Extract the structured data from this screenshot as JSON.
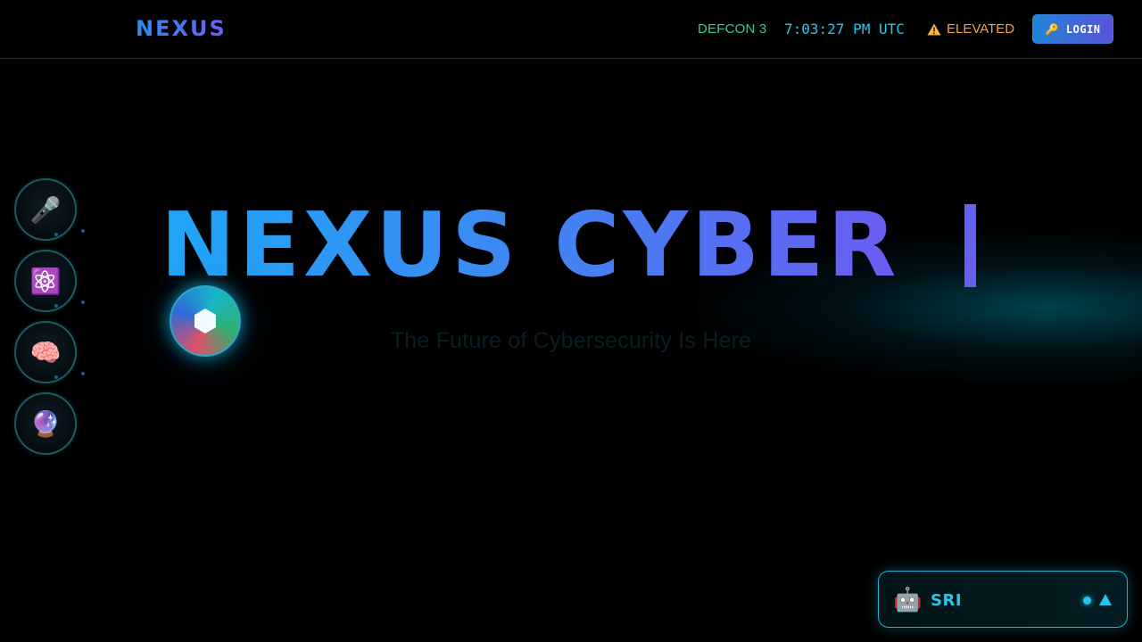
{
  "header": {
    "brand": "NEXUS",
    "defcon": "DEFCON 3",
    "clock": "7:03:27 PM UTC",
    "threat_level": "ELEVATED",
    "threat_icon": "warning-triangle-icon",
    "login_icon": "🔑",
    "login_label": "LOGIN"
  },
  "dock": {
    "items": [
      {
        "icon": "🎤",
        "icon_name": "microphone-icon"
      },
      {
        "icon": "⚛️",
        "icon_name": "atom-icon"
      },
      {
        "icon": "🧠",
        "icon_name": "brain-icon"
      },
      {
        "icon": "🔮",
        "icon_name": "crystal-ball-icon"
      }
    ]
  },
  "hero": {
    "title": "NEXUS CYBER",
    "subtitle": "The Future of Cybersecurity Is Here",
    "orb_icon": "hexagon-icon"
  },
  "assistant": {
    "icon": "🤖",
    "name": "SRI",
    "expand_icon": "triangle-up-icon"
  },
  "colors": {
    "background": "#000000",
    "accent_cyan": "#29c6f0",
    "accent_blue": "#3b8af2",
    "accent_violet": "#6a5cf2",
    "defcon_green": "#2fd08a",
    "threat_orange": "#f0a63a"
  }
}
